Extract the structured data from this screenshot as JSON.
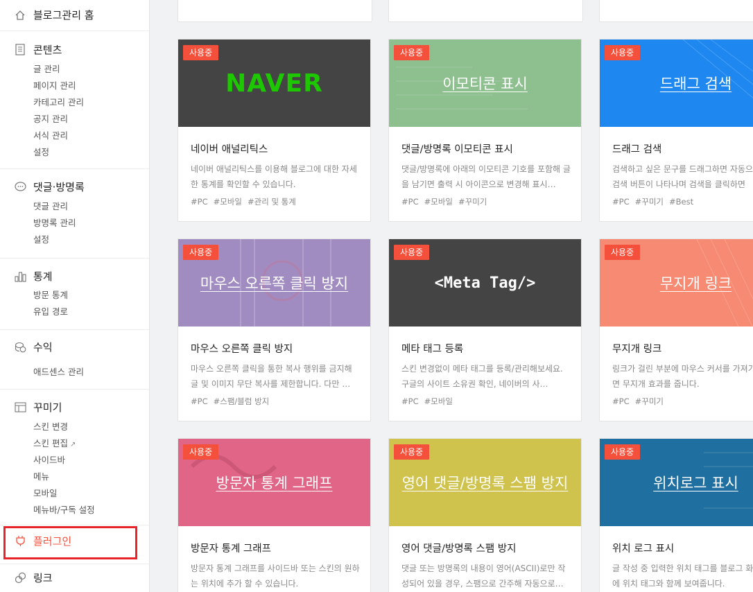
{
  "sidebar": {
    "home": "블로그관리 홈",
    "sections": [
      {
        "title": "콘텐츠",
        "icon": "document-icon",
        "items": [
          "글 관리",
          "페이지 관리",
          "카테고리 관리",
          "공지 관리",
          "서식 관리",
          "설정"
        ]
      },
      {
        "title": "댓글·방명록",
        "icon": "speech-bubble-icon",
        "items": [
          "댓글 관리",
          "방명록 관리",
          "설정"
        ]
      },
      {
        "title": "통계",
        "icon": "bar-chart-icon",
        "items": [
          "방문 통계",
          "유입 경로"
        ]
      },
      {
        "title": "수익",
        "icon": "coins-icon",
        "items": [
          "애드센스 관리"
        ]
      },
      {
        "title": "꾸미기",
        "icon": "layout-icon",
        "items": [
          "스킨 변경",
          "스킨 편집",
          "사이드바",
          "메뉴",
          "모바일",
          "메뉴바/구독 설정"
        ]
      },
      {
        "title": "플러그인",
        "icon": "plug-icon"
      },
      {
        "title": "링크",
        "icon": "link-icon"
      }
    ],
    "accent": "#f4503c",
    "highlight_color": "#e8232a"
  },
  "badge_label": "사용중",
  "cards": [
    {
      "thumb": "NAVER",
      "title": "네이버 애널리틱스",
      "desc": "네이버 애널리틱스를 이용해 블로그에 대한 자세한 통계를 확인할 수 있습니다.",
      "tags": [
        "#PC",
        "#모바일",
        "#관리 및 통계"
      ],
      "bg": "#444444"
    },
    {
      "thumb": "이모티콘 표시",
      "title": "댓글/방명록 이모티콘 표시",
      "desc": "댓글/방명록에 아래의 이모티콘 기호를 포함해 글을 남기면 출력 시 아이콘으로 변경해 표시…",
      "tags": [
        "#PC",
        "#모바일",
        "#꾸미기"
      ],
      "bg": "#8dbf8f"
    },
    {
      "thumb": "드래그 검색",
      "title": "드래그 검색",
      "desc": "검색하고 싶은 문구를 드래그하면 자동으로 검색 버튼이 나타나며 검색을 클릭하면 새…",
      "tags": [
        "#PC",
        "#꾸미기",
        "#Best"
      ],
      "bg": "#1e88f0"
    },
    {
      "thumb": "마우스 오른쪽 클릭 방지",
      "title": "마우스 오른쪽 클릭 방지",
      "desc": "마우스 오른쪽 클릭을 통한 복사 행위를 금지해 글 및 이미지 무단 복사를 제한합니다. 다만 …",
      "tags": [
        "#PC",
        "#스팸/블럼 방지"
      ],
      "bg": "#a18cc2"
    },
    {
      "thumb": "<Meta Tag/>",
      "title": "메타 태그 등록",
      "desc": "스킨 변경없이 메타 태그를 등록/관리해보세요. 구글의 사이트 소유권 확인, 네이버의 사…",
      "tags": [
        "#PC",
        "#모바일"
      ],
      "bg": "#444444"
    },
    {
      "thumb": "무지개 링크",
      "title": "무지개 링크",
      "desc": "링크가 걸린 부분에 마우스 커서를 가져가면 무지개 효과를 줍니다.",
      "tags": [
        "#PC",
        "#꾸미기"
      ],
      "bg": "#f68a72"
    },
    {
      "thumb": "방문자 통계 그래프",
      "title": "방문자 통계 그래프",
      "desc": "방문자 통계 그래프를 사이드바 또는 스킨의 원하는 위치에 추가 할 수 있습니다.",
      "tags": [],
      "bg": "#e06587"
    },
    {
      "thumb": "영어 댓글/방명록 스팸 방지",
      "title": "영어 댓글/방명록 스팸 방지",
      "desc": "댓글 또는 방명록의 내용이 영어(ASCII)로만 작성되어 있을 경우, 스팸으로 간주해 자동으로…",
      "tags": [],
      "bg": "#cfc34d"
    },
    {
      "thumb": "위치로그 표시",
      "title": "위치 로그 표시",
      "desc": "글 작성 중 입력한 위치 태그를 블로그 화면에 위치 태그와 함께 보여줍니다.",
      "tags": [],
      "bg": "#1f6fa0"
    }
  ]
}
